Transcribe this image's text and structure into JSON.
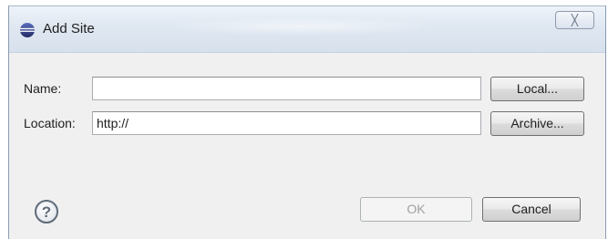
{
  "window": {
    "title": "Add Site",
    "close_glyph": "╳",
    "app_icon": "eclipse-icon"
  },
  "form": {
    "name_label": "Name:",
    "name_value": "",
    "location_label": "Location:",
    "location_value": "http://"
  },
  "buttons": {
    "local_label": "Local...",
    "archive_label": "Archive...",
    "ok_label": "OK",
    "cancel_label": "Cancel",
    "ok_enabled": false
  },
  "help": {
    "icon": "help-icon",
    "glyph": "?"
  },
  "colors": {
    "window_bg": "#f0f0f0",
    "title_gradient_top": "#eef3f9",
    "title_gradient_bottom": "#d7e1ed",
    "disabled_text": "#a0a0a0",
    "help_icon_color": "#5f6b78"
  }
}
